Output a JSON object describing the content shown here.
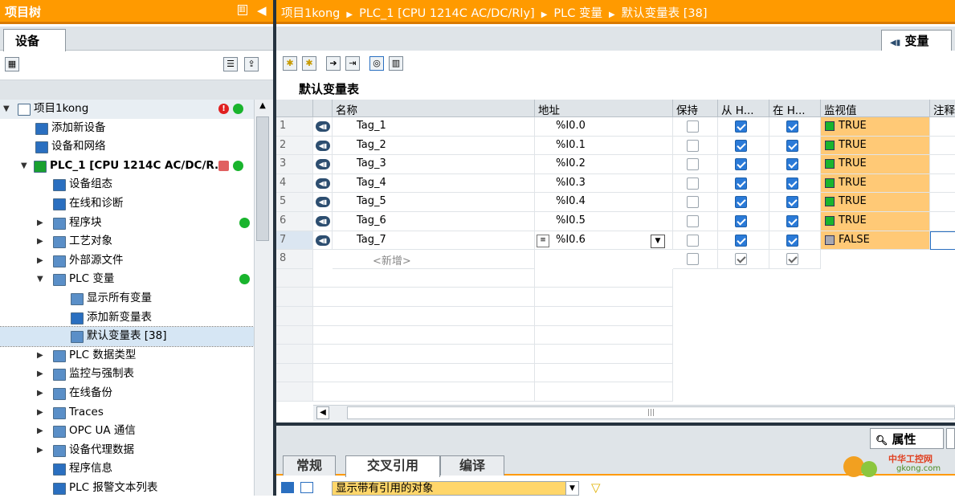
{
  "left_panel": {
    "title": "项目树",
    "tab": "设备",
    "tree": [
      {
        "label": "项目1kong",
        "level": 0,
        "arrow": "▼",
        "icon": "project-icon",
        "icon_color": "#ffffff",
        "status": [
          "error",
          "ok"
        ]
      },
      {
        "label": "添加新设备",
        "level": 1,
        "arrow": "",
        "icon": "add-device-icon",
        "icon_color": "#2a6fc0",
        "status": []
      },
      {
        "label": "设备和网络",
        "level": 1,
        "arrow": "",
        "icon": "network-icon",
        "icon_color": "#2a6fc0",
        "status": []
      },
      {
        "label": "PLC_1 [CPU 1214C AC/DC/R...",
        "level": 1,
        "arrow": "▼",
        "icon": "plc-icon",
        "icon_color": "#19a030",
        "status": [
          "mixed",
          "ok"
        ]
      },
      {
        "label": "设备组态",
        "level": 2,
        "arrow": "",
        "icon": "device-config-icon",
        "icon_color": "#2a6fc0",
        "status": []
      },
      {
        "label": "在线和诊断",
        "level": 2,
        "arrow": "",
        "icon": "diagnostics-icon",
        "icon_color": "#2a6fc0",
        "status": []
      },
      {
        "label": "程序块",
        "level": 2,
        "arrow": "▶",
        "icon": "folder-icon",
        "icon_color": "#5a8fc8",
        "status": [
          "ok"
        ]
      },
      {
        "label": "工艺对象",
        "level": 2,
        "arrow": "▶",
        "icon": "folder-icon",
        "icon_color": "#5a8fc8",
        "status": []
      },
      {
        "label": "外部源文件",
        "level": 2,
        "arrow": "▶",
        "icon": "folder-icon",
        "icon_color": "#5a8fc8",
        "status": []
      },
      {
        "label": "PLC 变量",
        "level": 2,
        "arrow": "▼",
        "icon": "folder-icon",
        "icon_color": "#5a8fc8",
        "status": [
          "ok"
        ]
      },
      {
        "label": "显示所有变量",
        "level": 3,
        "arrow": "",
        "icon": "show-tags-icon",
        "icon_color": "#5a8fc8",
        "status": []
      },
      {
        "label": "添加新变量表",
        "level": 3,
        "arrow": "",
        "icon": "add-table-icon",
        "icon_color": "#2a6fc0",
        "status": []
      },
      {
        "label": "默认变量表 [38]",
        "level": 3,
        "arrow": "",
        "icon": "tag-table-icon",
        "icon_color": "#5a8fc8",
        "status": [],
        "selected": true
      },
      {
        "label": "PLC 数据类型",
        "level": 2,
        "arrow": "▶",
        "icon": "folder-icon",
        "icon_color": "#5a8fc8",
        "status": []
      },
      {
        "label": "监控与强制表",
        "level": 2,
        "arrow": "▶",
        "icon": "folder-icon",
        "icon_color": "#5a8fc8",
        "status": []
      },
      {
        "label": "在线备份",
        "level": 2,
        "arrow": "▶",
        "icon": "folder-icon",
        "icon_color": "#5a8fc8",
        "status": []
      },
      {
        "label": "Traces",
        "level": 2,
        "arrow": "▶",
        "icon": "folder-icon",
        "icon_color": "#5a8fc8",
        "status": []
      },
      {
        "label": "OPC UA 通信",
        "level": 2,
        "arrow": "▶",
        "icon": "folder-icon",
        "icon_color": "#5a8fc8",
        "status": []
      },
      {
        "label": "设备代理数据",
        "level": 2,
        "arrow": "▶",
        "icon": "folder-icon",
        "icon_color": "#5a8fc8",
        "status": []
      },
      {
        "label": "程序信息",
        "level": 2,
        "arrow": "",
        "icon": "program-info-icon",
        "icon_color": "#2a6fc0",
        "status": []
      },
      {
        "label": "PLC 报警文本列表",
        "level": 2,
        "arrow": "",
        "icon": "alarm-text-icon",
        "icon_color": "#2a6fc0",
        "status": []
      }
    ]
  },
  "breadcrumb": [
    "项目1kong",
    "PLC_1 [CPU 1214C AC/DC/Rly]",
    "PLC 变量",
    "默认变量表 [38]"
  ],
  "main_tab": "变量",
  "table_title": "默认变量表",
  "table": {
    "headers": [
      "名称",
      "地址",
      "保持",
      "从 H...",
      "在 H...",
      "监视值",
      "注释"
    ],
    "rows": [
      {
        "num": "1",
        "name": "Tag_1",
        "address": "%I0.0",
        "retain": false,
        "from_hmi": true,
        "in_hmi": true,
        "monitor": "TRUE",
        "monitor_color": "#19b42d"
      },
      {
        "num": "2",
        "name": "Tag_2",
        "address": "%I0.1",
        "retain": false,
        "from_hmi": true,
        "in_hmi": true,
        "monitor": "TRUE",
        "monitor_color": "#19b42d"
      },
      {
        "num": "3",
        "name": "Tag_3",
        "address": "%I0.2",
        "retain": false,
        "from_hmi": true,
        "in_hmi": true,
        "monitor": "TRUE",
        "monitor_color": "#19b42d"
      },
      {
        "num": "4",
        "name": "Tag_4",
        "address": "%I0.3",
        "retain": false,
        "from_hmi": true,
        "in_hmi": true,
        "monitor": "TRUE",
        "monitor_color": "#19b42d"
      },
      {
        "num": "5",
        "name": "Tag_5",
        "address": "%I0.4",
        "retain": false,
        "from_hmi": true,
        "in_hmi": true,
        "monitor": "TRUE",
        "monitor_color": "#19b42d"
      },
      {
        "num": "6",
        "name": "Tag_6",
        "address": "%I0.5",
        "retain": false,
        "from_hmi": true,
        "in_hmi": true,
        "monitor": "TRUE",
        "monitor_color": "#19b42d"
      },
      {
        "num": "7",
        "name": "Tag_7",
        "address": "%I0.6",
        "retain": false,
        "from_hmi": true,
        "in_hmi": true,
        "monitor": "FALSE",
        "monitor_color": "#a8a8b0",
        "active": true
      }
    ],
    "new_row": {
      "num": "8",
      "placeholder": "<新增>"
    }
  },
  "inspector": {
    "properties_tab": "属性",
    "tabs": [
      "常规",
      "交叉引用",
      "编译"
    ],
    "active_tab": "交叉引用",
    "filter_value": "显示带有引用的对象"
  },
  "watermark": {
    "line1": "中华工控网",
    "line2": "gkong.com"
  },
  "colors": {
    "accent": "#ff9a00",
    "accent_dark": "#d97a00",
    "ok": "#19b42d",
    "error": "#e02020",
    "monitor_bg": "#ffc976"
  }
}
